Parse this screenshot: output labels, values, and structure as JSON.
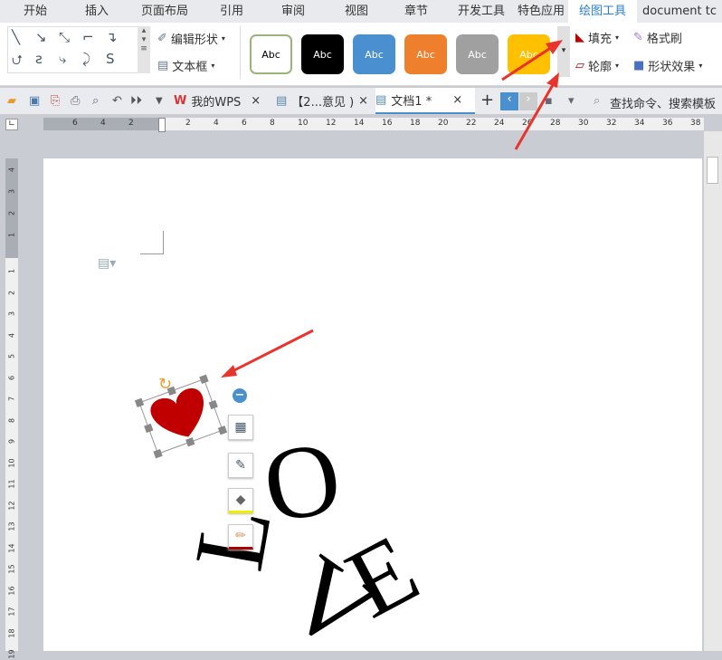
{
  "tabs": [
    "开始",
    "插入",
    "页面布局",
    "引用",
    "审阅",
    "视图",
    "章节",
    "开发工具",
    "特色应用",
    "绘图工具",
    "document tc"
  ],
  "ribbon": {
    "edit_shape": "编辑形状",
    "text_box": "文本框",
    "style_label": "Abc",
    "fill": "填充",
    "format_painter": "格式刷",
    "outline": "轮廓",
    "shape_effect": "形状效果",
    "styles": [
      {
        "bg": "#ffffff",
        "border": "#9ab47a",
        "fg": "#000"
      },
      {
        "bg": "#000000",
        "border": "#000",
        "fg": "#fff"
      },
      {
        "bg": "#4a8fd0",
        "border": "#3a78b8",
        "fg": "#fff"
      },
      {
        "bg": "#ee7f2d",
        "border": "#c86418",
        "fg": "#fff"
      },
      {
        "bg": "#a0a0a0",
        "border": "#888",
        "fg": "#fff"
      },
      {
        "bg": "#ffc000",
        "border": "#d9a300",
        "fg": "#fff"
      }
    ]
  },
  "quickbar": {
    "tabs": [
      {
        "label": "我的WPS"
      },
      {
        "label": "【2...意见 )"
      },
      {
        "label": "文档1 *"
      }
    ],
    "search": "查找命令、搜索模板"
  },
  "ruler": {
    "h": [
      "6",
      "4",
      "2",
      "2",
      "4",
      "6",
      "8",
      "10",
      "12",
      "14",
      "16",
      "18",
      "20",
      "22",
      "24",
      "26",
      "28",
      "30",
      "32",
      "34",
      "36",
      "38"
    ],
    "v": [
      "4",
      "3",
      "2",
      "1",
      "1",
      "2",
      "3",
      "4",
      "5",
      "6",
      "7",
      "8",
      "9",
      "10",
      "11",
      "12",
      "13",
      "14",
      "15",
      "16",
      "17",
      "18",
      "19"
    ]
  },
  "art": {
    "letters": [
      "L",
      "O",
      "V",
      "E"
    ],
    "heart_color": "#c00000",
    "arrow_color": "#e8342c"
  }
}
